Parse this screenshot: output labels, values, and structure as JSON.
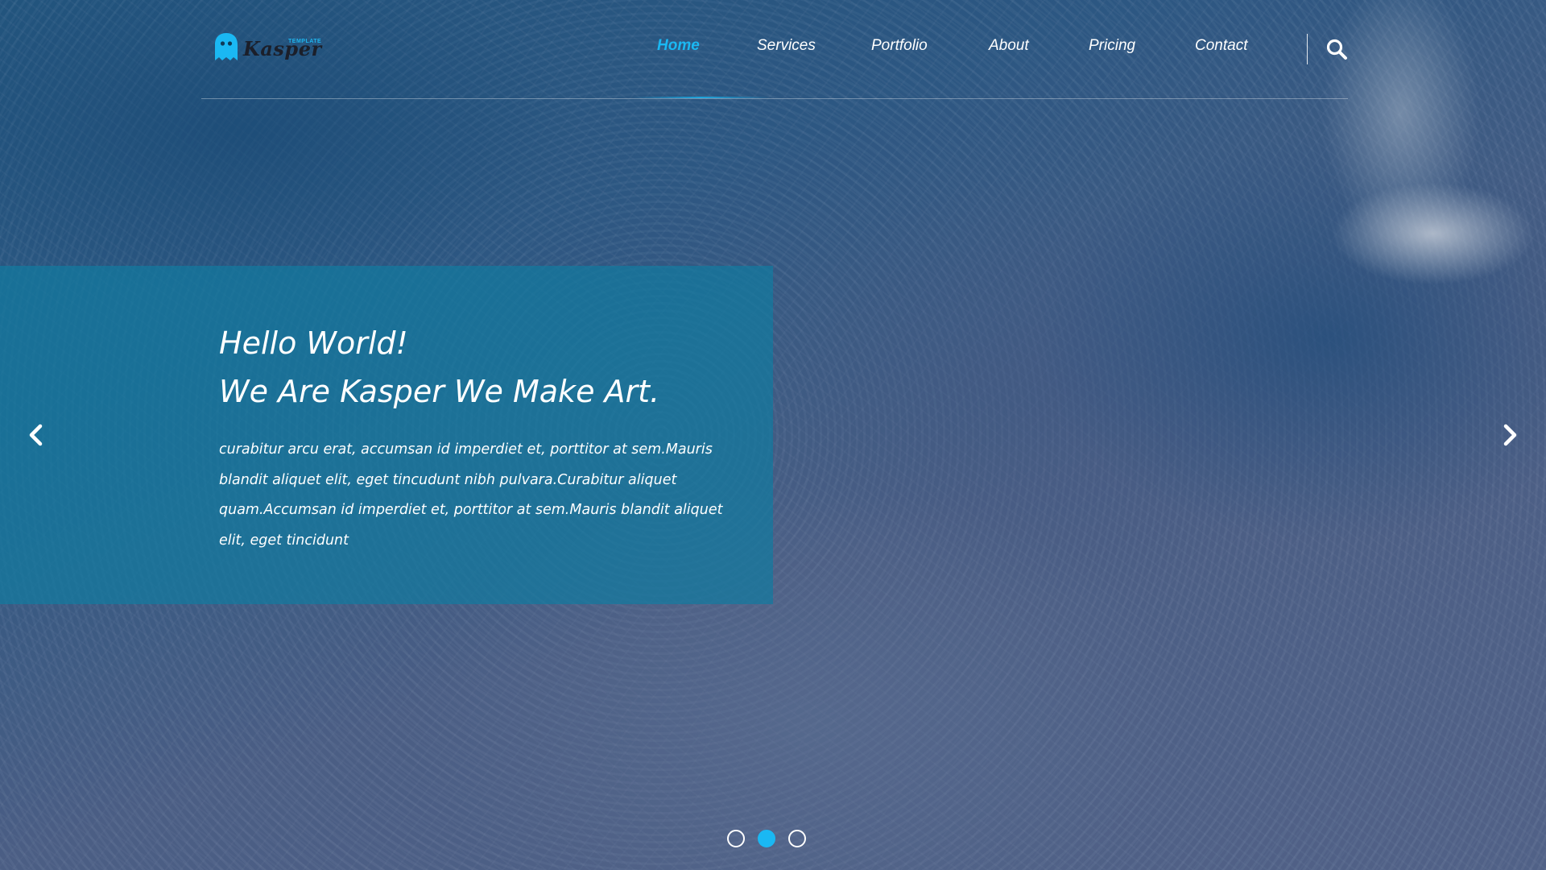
{
  "brand": {
    "name": "Kasper",
    "tagline": "TEMPLATE",
    "accent_color": "#1ab8f3"
  },
  "nav": {
    "items": [
      {
        "label": "Home",
        "active": true
      },
      {
        "label": "Services",
        "active": false
      },
      {
        "label": "Portfolio",
        "active": false
      },
      {
        "label": "About",
        "active": false
      },
      {
        "label": "Pricing",
        "active": false
      },
      {
        "label": "Contact",
        "active": false
      }
    ],
    "search_icon": "search-icon"
  },
  "hero": {
    "heading_line1": "Hello World!",
    "heading_line2": "We Are Kasper We Make Art.",
    "paragraph": "curabitur arcu erat, accumsan id imperdiet et, porttitor at sem.Mauris blandit aliquet elit, eget tincudunt nibh pulvara.Curabitur aliquet quam.Accumsan id imperdiet et, porttitor at sem.Mauris blandit aliquet elit, eget tincidunt",
    "box_color": "#127aa0"
  },
  "slider": {
    "prev_icon": "chevron-left-icon",
    "next_icon": "chevron-right-icon",
    "slides_count": 3,
    "active_index": 1
  }
}
